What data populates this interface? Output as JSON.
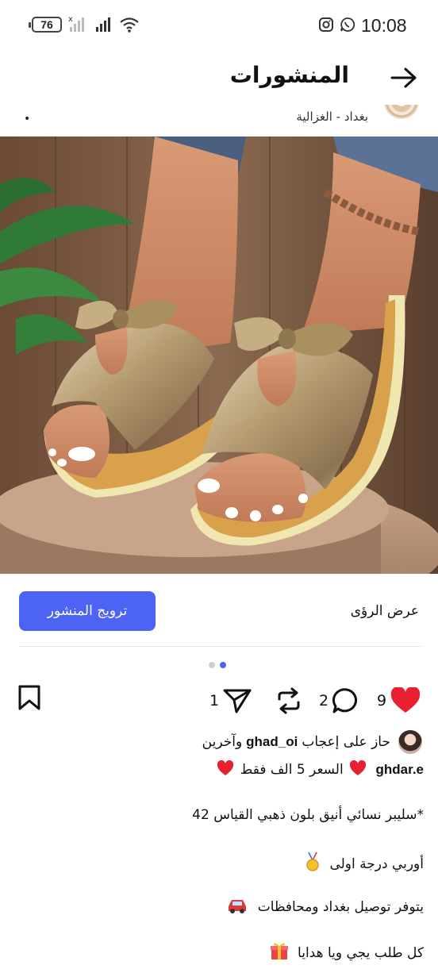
{
  "status_bar": {
    "battery": "76",
    "time": "10:08",
    "icons": [
      "battery-icon",
      "signal-x-icon",
      "signal-icon",
      "wifi-icon",
      "instagram-icon",
      "whatsapp-icon"
    ]
  },
  "header": {
    "title": "المنشورات",
    "back_icon": "arrow-right-icon"
  },
  "author": {
    "location": "بغداد - الغزالية"
  },
  "actions": {
    "insights_label": "عرض الرؤى",
    "promote_label": "ترويج المنشور"
  },
  "carousel": {
    "count": 2,
    "active_index": 1
  },
  "reactions": {
    "likes": "9",
    "comments": "2",
    "shares": "1"
  },
  "liked_by": {
    "prefix": "حاز على إعجاب",
    "user": "ghad_oi",
    "suffix": "وآخرين"
  },
  "caption": {
    "username": "ghdar.e",
    "price_text": "السعر 5 الف فقط",
    "line1": "*سليبر نسائي أنيق بلون ذهبي القياس 42",
    "line2": "أوربي درجة اولى",
    "line3": "يتوفر توصيل بغداد ومحافظات",
    "line4": "كل طلب يجي ويا هدايا"
  },
  "colors": {
    "accent": "#4d63f5",
    "heart": "#e8202f"
  }
}
